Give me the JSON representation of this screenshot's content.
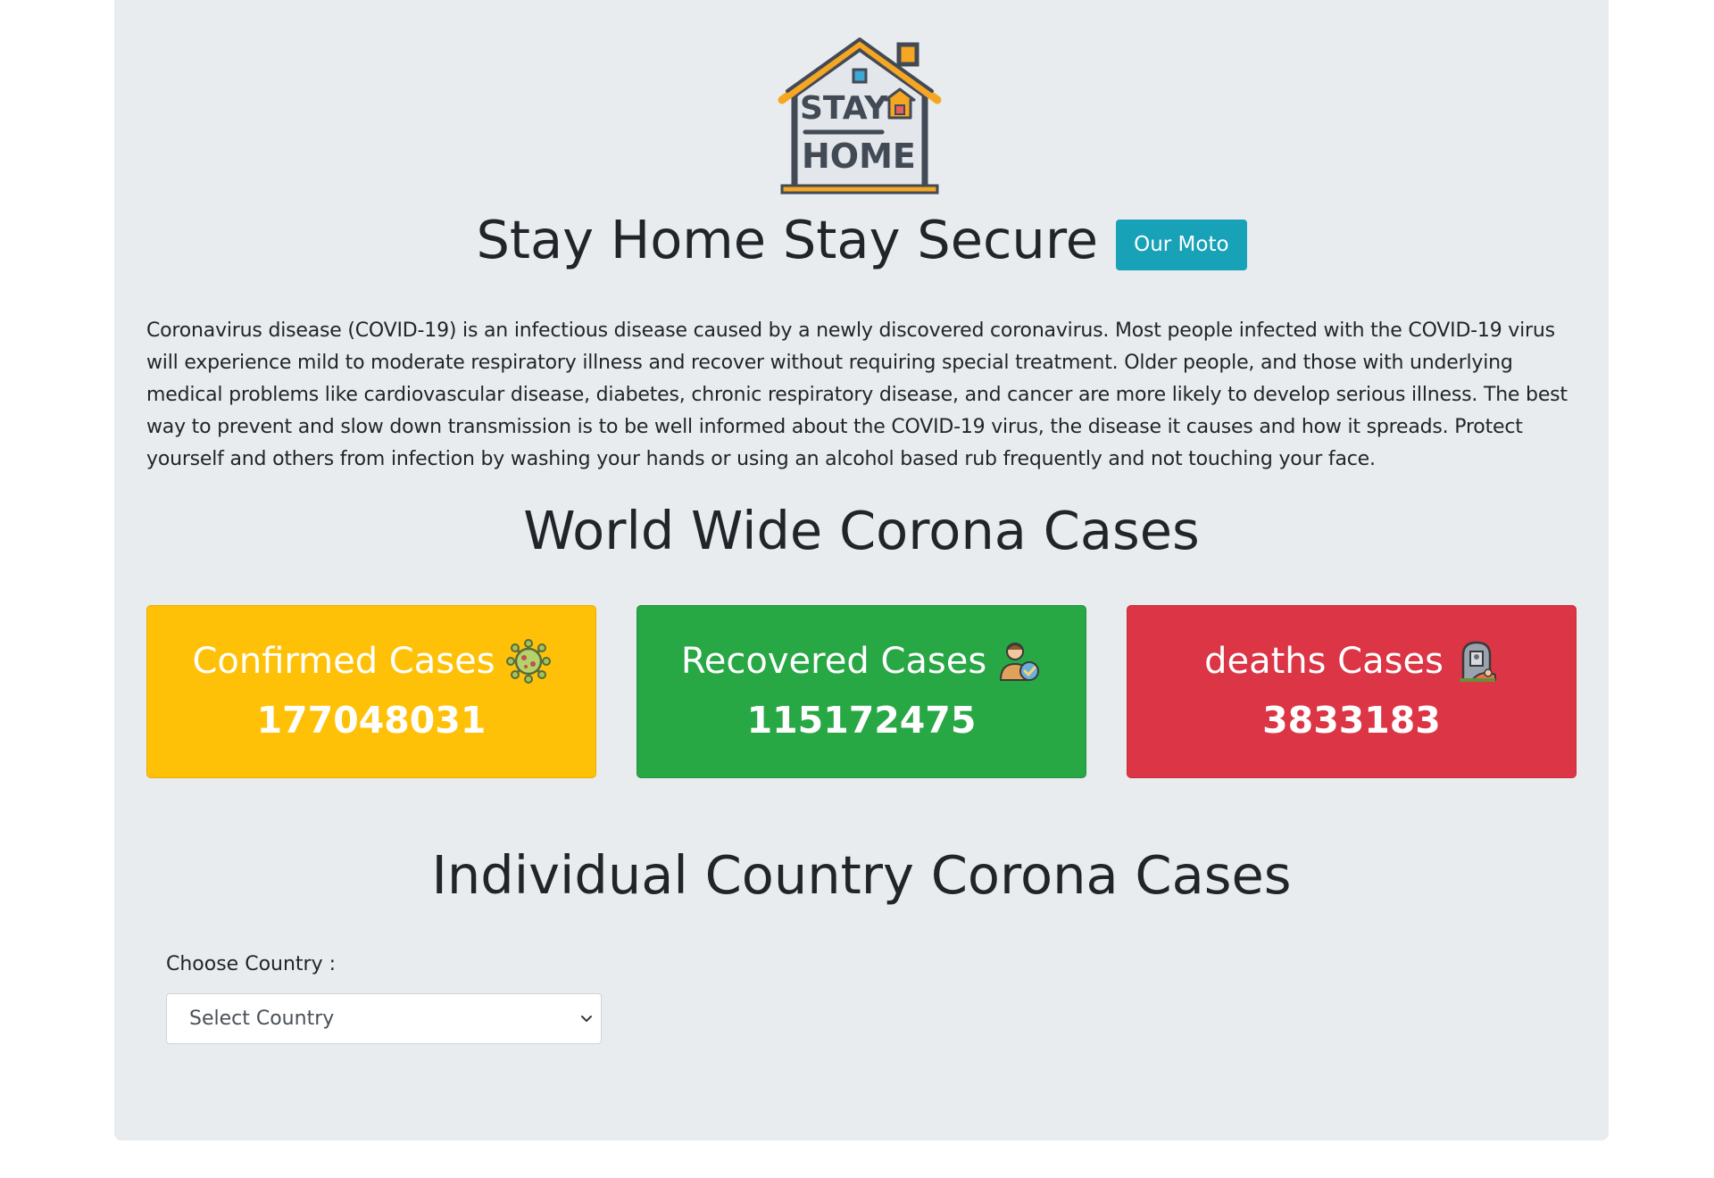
{
  "header": {
    "logo_text_line1": "STAY",
    "logo_text_line2": "HOME",
    "title": "Stay Home Stay Secure",
    "moto_button": "Our Moto"
  },
  "intro": {
    "text": "Coronavirus disease (COVID-19) is an infectious disease caused by a newly discovered coronavirus. Most people infected with the COVID-19 virus will experience mild to moderate respiratory illness and recover without requiring special treatment. Older people, and those with underlying medical problems like cardiovascular disease, diabetes, chronic respiratory disease, and cancer are more likely to develop serious illness. The best way to prevent and slow down transmission is to be well informed about the COVID-19 virus, the disease it causes and how it spreads. Protect yourself and others from infection by washing your hands or using an alcohol based rub frequently and not touching your face."
  },
  "world": {
    "heading": "World Wide Corona Cases",
    "cards": [
      {
        "label": "Confirmed Cases",
        "value": "177048031",
        "icon": "virus-icon",
        "color": "#ffc107"
      },
      {
        "label": "Recovered Cases",
        "value": "115172475",
        "icon": "recovered-person-icon",
        "color": "#28a745"
      },
      {
        "label": "deaths Cases",
        "value": "3833183",
        "icon": "tombstone-icon",
        "color": "#dc3545"
      }
    ]
  },
  "country": {
    "heading": "Individual Country Corona Cases",
    "choose_label": "Choose Country :",
    "select_value": "Select Country"
  },
  "colors": {
    "background": "#e9ecef",
    "accent": "#17a2b8"
  }
}
